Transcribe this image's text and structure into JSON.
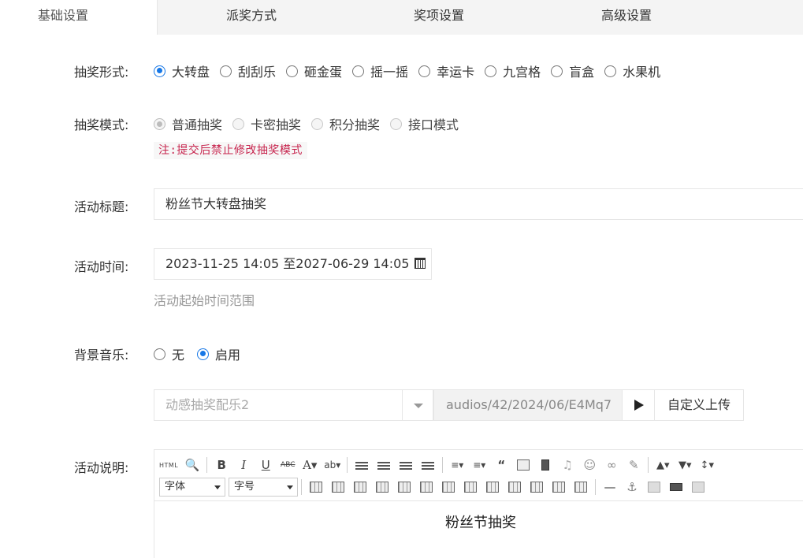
{
  "tabs": [
    {
      "label": "基础设置",
      "active": true
    },
    {
      "label": "派奖方式",
      "active": false
    },
    {
      "label": "奖项设置",
      "active": false
    },
    {
      "label": "高级设置",
      "active": false
    }
  ],
  "lottery_form": {
    "label": "抽奖形式:",
    "options": [
      "大转盘",
      "刮刮乐",
      "砸金蛋",
      "摇一摇",
      "幸运卡",
      "九宫格",
      "盲盒",
      "水果机"
    ],
    "selected": "大转盘"
  },
  "lottery_mode": {
    "label": "抽奖模式:",
    "options": [
      "普通抽奖",
      "卡密抽奖",
      "积分抽奖",
      "接口模式"
    ],
    "selected": "普通抽奖",
    "note": "注:提交后禁止修改抽奖模式"
  },
  "activity_title": {
    "label": "活动标题:",
    "value": "粉丝节大转盘抽奖"
  },
  "activity_time": {
    "label": "活动时间:",
    "value": "2023-11-25 14:05 至2027-06-29 14:05",
    "hint": "活动起始时间范围",
    "icon": "calendar-icon"
  },
  "bg_music": {
    "label": "背景音乐:",
    "options": [
      "无",
      "启用"
    ],
    "selected": "启用",
    "select_value": "动感抽奖配乐2",
    "path": "audios/42/2024/06/E4Mq7",
    "upload_label": "自定义上传"
  },
  "description": {
    "label": "活动说明:",
    "font_select": "字体",
    "size_select": "字号",
    "content": "粉丝节抽奖"
  },
  "colors": {
    "accent": "#1677e6",
    "note_text": "#c7254e",
    "tab_bg": "#f4f4f4"
  }
}
